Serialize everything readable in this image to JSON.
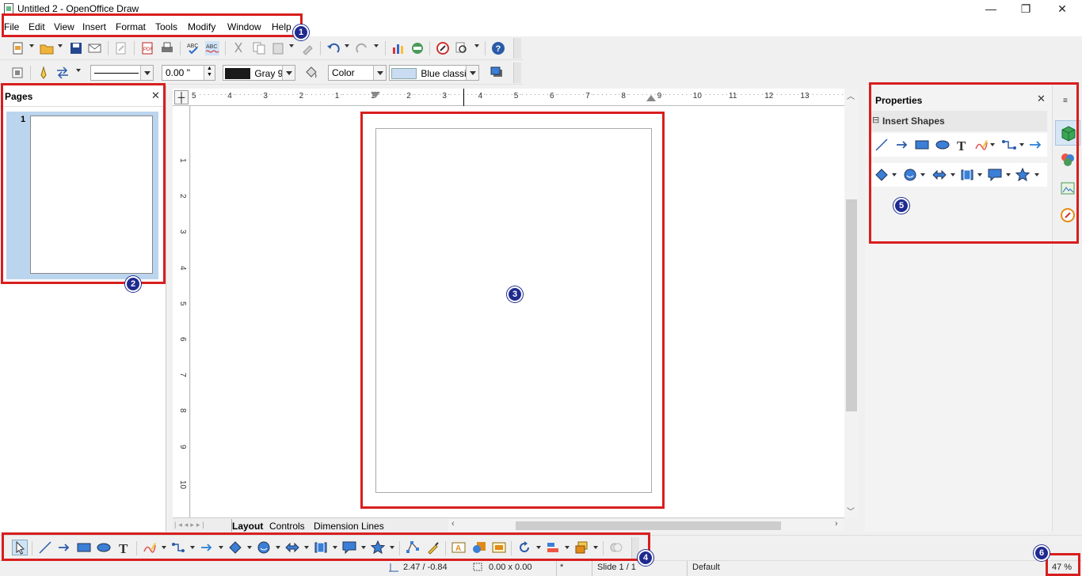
{
  "window": {
    "title": "Untitled 2 - OpenOffice Draw",
    "minimize": "—",
    "restore": "❐",
    "close": "✕"
  },
  "menu": [
    {
      "label": "File",
      "name": "menu-file"
    },
    {
      "label": "Edit",
      "name": "menu-edit"
    },
    {
      "label": "View",
      "name": "menu-view"
    },
    {
      "label": "Insert",
      "name": "menu-insert"
    },
    {
      "label": "Format",
      "name": "menu-format"
    },
    {
      "label": "Tools",
      "name": "menu-tools"
    },
    {
      "label": "Modify",
      "name": "menu-modify"
    },
    {
      "label": "Window",
      "name": "menu-window"
    },
    {
      "label": "Help",
      "name": "menu-help"
    }
  ],
  "line_fill_toolbar": {
    "line_width": "0.00 \"",
    "line_color": "Gray 9",
    "area_style": "Color",
    "area_fill": "Blue classic",
    "line_color_hex": "#1a1a1a",
    "area_fill_hex": "#c9dcf1"
  },
  "pages_panel": {
    "title": "Pages",
    "close": "✕",
    "page_number": "1"
  },
  "ruler": {
    "h_ticks": [
      "5",
      "4",
      "3",
      "2",
      "1",
      "1",
      "2",
      "3",
      "4",
      "5",
      "6",
      "7",
      "8",
      "9",
      "10",
      "11",
      "12",
      "13"
    ],
    "v_ticks": [
      "1",
      "2",
      "3",
      "4",
      "5",
      "6",
      "7",
      "8",
      "9",
      "10"
    ]
  },
  "layer_tabs": [
    "Layout",
    "Controls",
    "Dimension Lines"
  ],
  "properties": {
    "title": "Properties",
    "close": "✕",
    "section": "Insert Shapes",
    "section_toggle": "⊟"
  },
  "statusbar": {
    "position": "2.47 / -0.84",
    "size": "0.00 x 0.00",
    "modified": "*",
    "slide": "Slide 1 / 1",
    "layout": "Default",
    "zoom": "47 %"
  },
  "callouts": [
    "1",
    "2",
    "3",
    "4",
    "5",
    "6"
  ]
}
